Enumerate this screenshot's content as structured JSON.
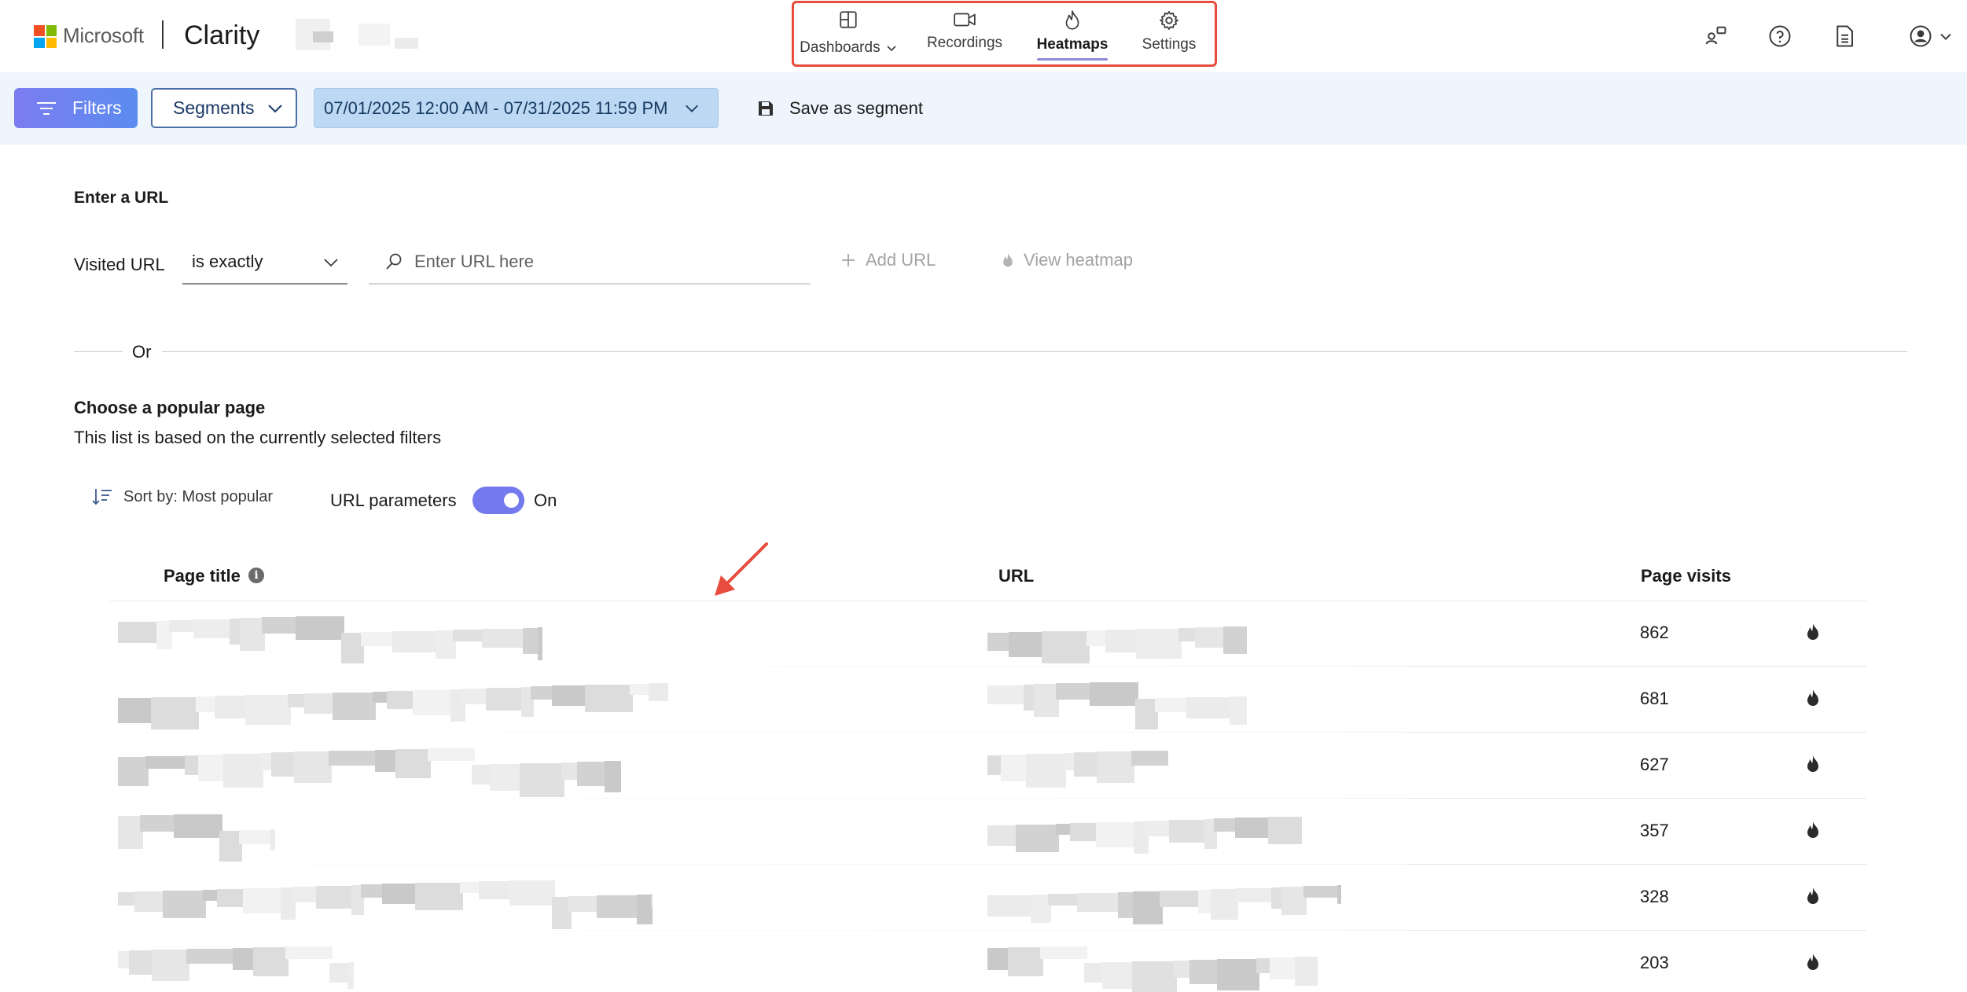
{
  "brand": {
    "company": "Microsoft",
    "product": "Clarity"
  },
  "nav": [
    {
      "id": "dashboards",
      "label": "Dashboards",
      "icon": "dashboard-icon",
      "has_dropdown": true,
      "active": false
    },
    {
      "id": "recordings",
      "label": "Recordings",
      "icon": "video-camera-icon",
      "active": false
    },
    {
      "id": "heatmaps",
      "label": "Heatmaps",
      "icon": "flame-icon",
      "active": true
    },
    {
      "id": "settings",
      "label": "Settings",
      "icon": "gear-icon",
      "active": false
    }
  ],
  "top_icons": [
    "people-icon",
    "help-icon",
    "document-icon",
    "account-icon"
  ],
  "filterbar": {
    "filters_label": "Filters",
    "segments_label": "Segments",
    "date_range": "07/01/2025 12:00 AM - 07/31/2025 11:59 PM",
    "save_label": "Save as segment"
  },
  "enter_url": {
    "heading": "Enter a URL",
    "visited_label": "Visited URL",
    "operator": "is exactly",
    "placeholder": "Enter URL here",
    "add_label": "Add URL",
    "view_label": "View heatmap"
  },
  "divider_text": "Or",
  "popular": {
    "heading": "Choose a popular page",
    "subheading": "This list is based on the currently selected filters",
    "sort_label": "Sort by: Most popular",
    "params_label": "URL parameters",
    "params_state": "On",
    "columns": {
      "title": "Page title",
      "url": "URL",
      "visits": "Page visits"
    },
    "rows": [
      {
        "visits": "862"
      },
      {
        "visits": "681"
      },
      {
        "visits": "627"
      },
      {
        "visits": "357"
      },
      {
        "visits": "328"
      },
      {
        "visits": "203"
      }
    ]
  },
  "colors": {
    "accent": "#7579ee",
    "annotation_red": "#e74c3c",
    "filterbar_bg": "#eef5fc",
    "date_bg": "#bcd8f2"
  }
}
